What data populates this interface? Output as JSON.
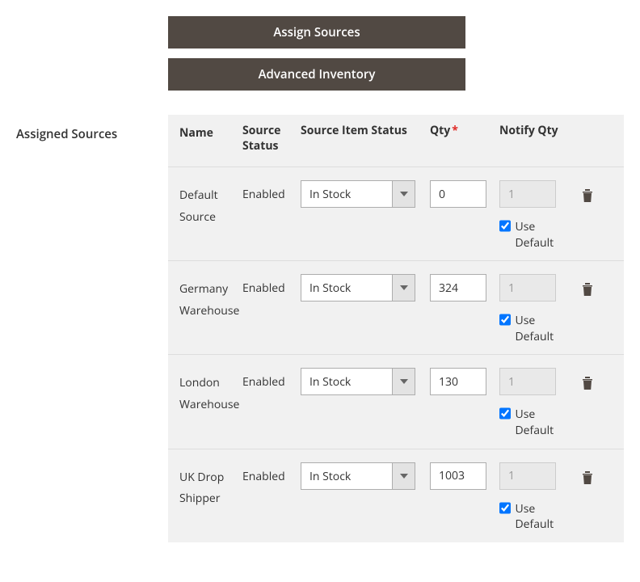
{
  "buttons": {
    "assign_sources": "Assign Sources",
    "advanced_inventory": "Advanced Inventory"
  },
  "section_label": "Assigned Sources",
  "headers": {
    "name": "Name",
    "source_status": "Source Status",
    "source_item_status": "Source Item Status",
    "qty": "Qty",
    "notify_qty": "Notify Qty"
  },
  "use_default_label": "Use Default",
  "rows": [
    {
      "name": "Default Source",
      "status": "Enabled",
      "item_status": "In Stock",
      "qty": "0",
      "notify_qty": "1",
      "use_default": true
    },
    {
      "name": "Germany Warehouse",
      "status": "Enabled",
      "item_status": "In Stock",
      "qty": "324",
      "notify_qty": "1",
      "use_default": true
    },
    {
      "name": "London Warehouse",
      "status": "Enabled",
      "item_status": "In Stock",
      "qty": "130",
      "notify_qty": "1",
      "use_default": true
    },
    {
      "name": "UK Drop Shipper",
      "status": "Enabled",
      "item_status": "In Stock",
      "qty": "1003",
      "notify_qty": "1",
      "use_default": true
    }
  ]
}
